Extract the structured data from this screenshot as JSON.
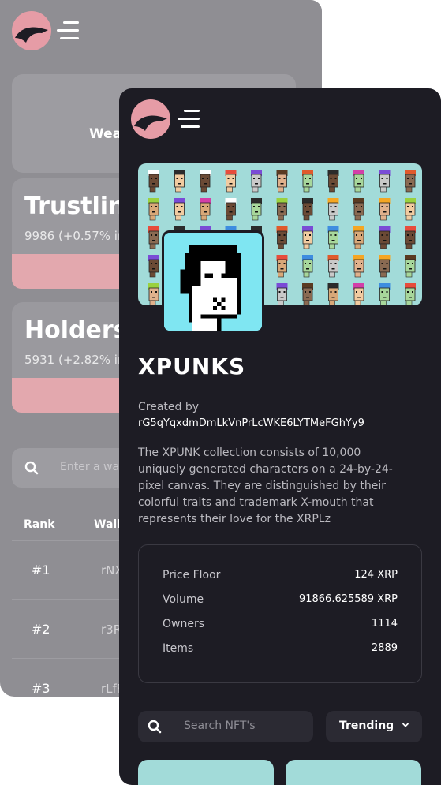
{
  "back": {
    "card_top_label": "Wea",
    "trustlines": {
      "title": "Trustline",
      "sub": "9986 (+0.57% in"
    },
    "holders": {
      "title": "Holders",
      "sub": "5931 (+2.82% in"
    },
    "search_placeholder": "Enter a wa",
    "columns": [
      "Rank",
      "Wall"
    ],
    "rows": [
      {
        "rank": "#1",
        "wallet": "rNX"
      },
      {
        "rank": "#2",
        "wallet": "r3R"
      },
      {
        "rank": "#3",
        "wallet": "rLfF"
      }
    ]
  },
  "collection": {
    "title": "XPUNKS",
    "created_label": "Created by",
    "creator": "rG5qYqxdmDmLkVnPrLcWKE6LYTMeFGhYy9",
    "description": "The XPUNK collection consists of 10,000 uniquely generated characters on a 24-by-24-pixel canvas. They are distinguished by their colorful traits and trademark X-mouth that represents their love for the XRPLz"
  },
  "stats": [
    {
      "label": "Price Floor",
      "value": "124 XRP"
    },
    {
      "label": "Volume",
      "value": "91866.625589 XRP"
    },
    {
      "label": "Owners",
      "value": "1114"
    },
    {
      "label": "Items",
      "value": "2889"
    }
  ],
  "controls": {
    "search_placeholder": "Search NFT's",
    "sort_label": "Trending"
  },
  "icons": {
    "logo": "eagle-logo-icon",
    "menu": "hamburger-menu-icon",
    "search": "search-icon",
    "chevron": "chevron-down-icon"
  },
  "colors": {
    "accent": "#e69ca6",
    "dark_bg": "#1d1c24",
    "banner": "#a2dbd9"
  }
}
